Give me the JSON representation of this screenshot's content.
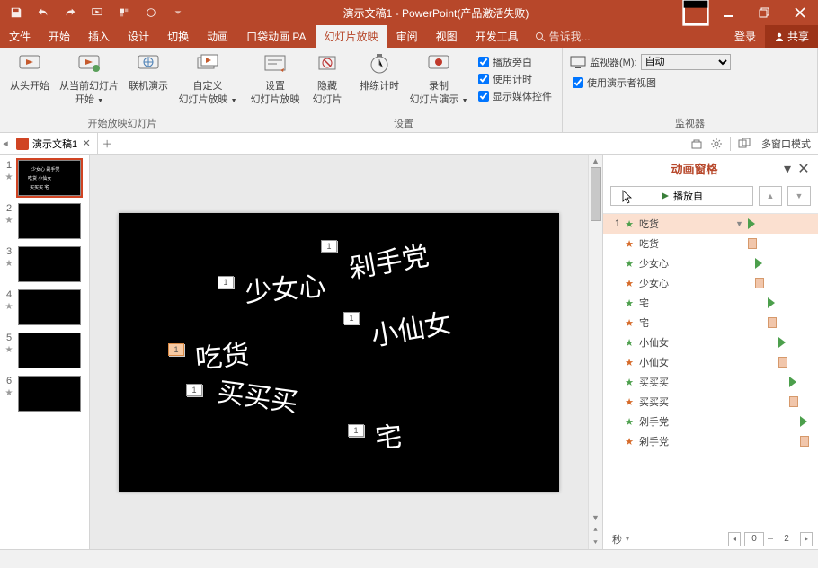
{
  "title": "演示文稿1 - PowerPoint(产品激活失败)",
  "qat_icons": [
    "save",
    "undo",
    "redo",
    "start",
    "grid",
    "circle",
    "more"
  ],
  "tabs": [
    "文件",
    "开始",
    "插入",
    "设计",
    "切换",
    "动画",
    "口袋动画 PA",
    "幻灯片放映",
    "审阅",
    "视图",
    "开发工具"
  ],
  "activeTab": 7,
  "tellMe": "告诉我...",
  "login": "登录",
  "share": "共享",
  "ribbon": {
    "group1": {
      "title": "开始放映幻灯片",
      "btns": [
        {
          "l1": "从头开始",
          "l2": ""
        },
        {
          "l1": "从当前幻灯片",
          "l2": "开始"
        },
        {
          "l1": "联机演示",
          "l2": ""
        },
        {
          "l1": "自定义",
          "l2": "幻灯片放映"
        }
      ]
    },
    "group2": {
      "title": "设置",
      "btns": [
        {
          "l1": "设置",
          "l2": "幻灯片放映"
        },
        {
          "l1": "隐藏",
          "l2": "幻灯片"
        },
        {
          "l1": "排练计时",
          "l2": ""
        },
        {
          "l1": "录制",
          "l2": "幻灯片演示"
        }
      ],
      "chks": [
        "播放旁白",
        "使用计时",
        "显示媒体控件"
      ]
    },
    "group3": {
      "title": "监视器",
      "mon_label": "监视器(M):",
      "mon_sel": "自动",
      "chk": "使用演示者视图"
    }
  },
  "doctab": {
    "name": "演示文稿1"
  },
  "multiWindow": "多窗口模式",
  "thumbs": [
    1,
    2,
    3,
    4,
    5,
    6
  ],
  "slideTexts": {
    "t1": "剁手党",
    "t2": "少女心",
    "t3": "小仙女",
    "t4": "吃货",
    "t5": "买买买",
    "t6": "宅"
  },
  "animPane": {
    "title": "动画窗格",
    "playFrom": "播放自",
    "rows": [
      {
        "num": "1",
        "kind": "green",
        "name": "吃货",
        "sel": true,
        "dd": true,
        "tl": {
          "tri": 0
        }
      },
      {
        "num": "",
        "kind": "orange",
        "name": "吃货",
        "tl": {
          "bar": [
            0,
            10
          ]
        }
      },
      {
        "num": "",
        "kind": "green",
        "name": "少女心",
        "tl": {
          "tri": 8
        }
      },
      {
        "num": "",
        "kind": "orange",
        "name": "少女心",
        "tl": {
          "bar": [
            8,
            18
          ]
        }
      },
      {
        "num": "",
        "kind": "green",
        "name": "宅",
        "tl": {
          "tri": 22
        }
      },
      {
        "num": "",
        "kind": "orange",
        "name": "宅",
        "tl": {
          "bar": [
            22,
            32
          ]
        }
      },
      {
        "num": "",
        "kind": "green",
        "name": "小仙女",
        "tl": {
          "tri": 34
        }
      },
      {
        "num": "",
        "kind": "orange",
        "name": "小仙女",
        "tl": {
          "bar": [
            34,
            44
          ]
        }
      },
      {
        "num": "",
        "kind": "green",
        "name": "买买买",
        "tl": {
          "tri": 46
        }
      },
      {
        "num": "",
        "kind": "orange",
        "name": "买买买",
        "tl": {
          "bar": [
            46,
            56
          ]
        }
      },
      {
        "num": "",
        "kind": "green",
        "name": "剁手党",
        "tl": {
          "tri": 58
        }
      },
      {
        "num": "",
        "kind": "orange",
        "name": "剁手党",
        "tl": {
          "bar": [
            58,
            68
          ]
        }
      }
    ],
    "footer": {
      "sec": "秒",
      "nav": [
        "0",
        "2"
      ]
    }
  }
}
